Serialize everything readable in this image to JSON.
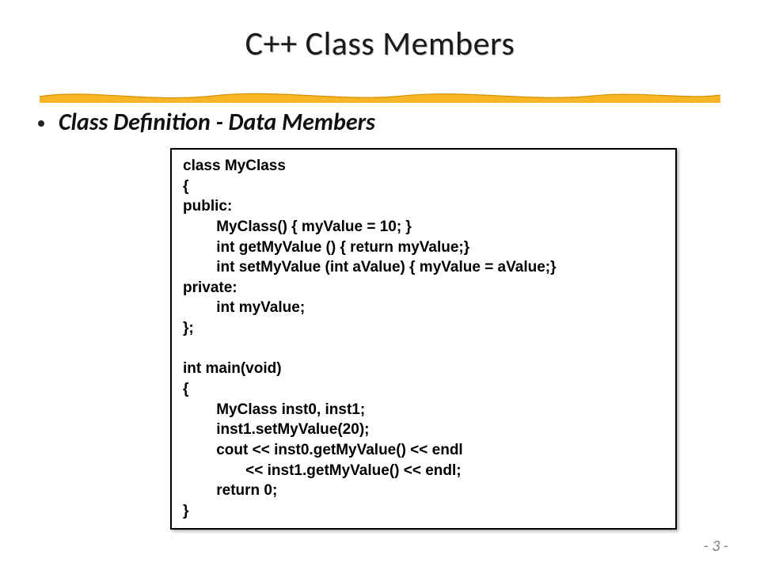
{
  "title": "C++ Class Members",
  "bullet": "Class Definition - Data Members",
  "code": "class MyClass\n{\npublic:\n        MyClass() { myValue = 10; }\n        int getMyValue () { return myValue;}\n        int setMyValue (int aValue) { myValue = aValue;}\nprivate:\n        int myValue;\n};\n\nint main(void)\n{\n        MyClass inst0, inst1;\n        inst1.setMyValue(20);\n        cout << inst0.getMyValue() << endl\n               << inst1.getMyValue() << endl;\n        return 0;\n}",
  "page_number": "- 3 -"
}
